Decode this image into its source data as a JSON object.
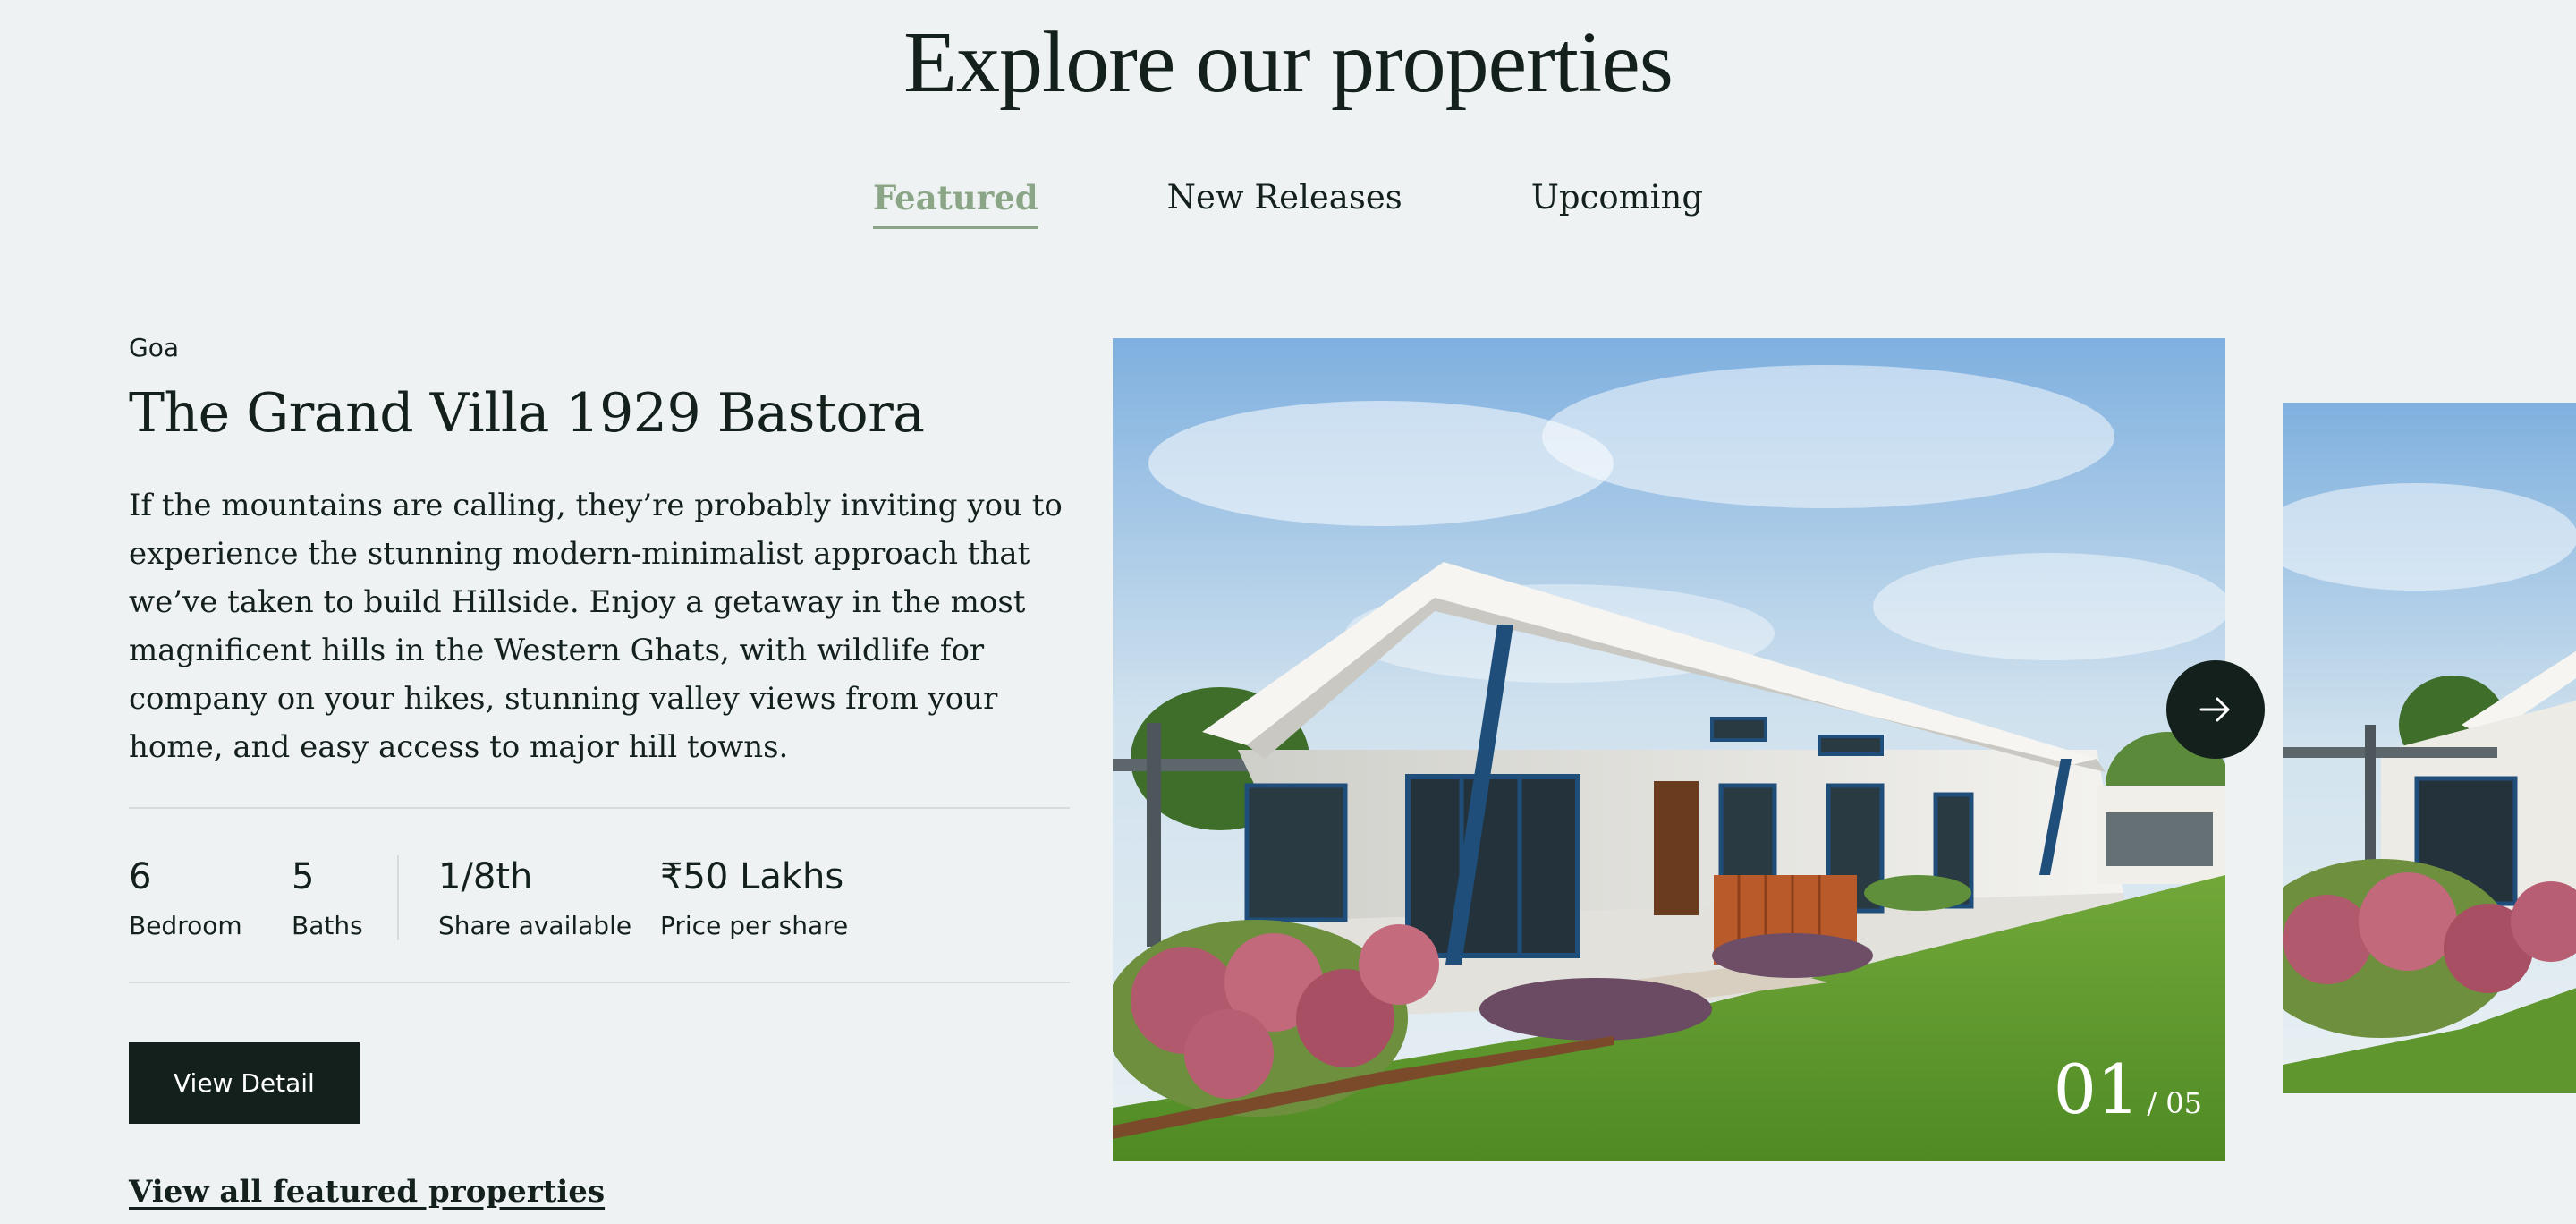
{
  "section": {
    "title": "Explore our properties"
  },
  "tabs": [
    {
      "label": "Featured",
      "active": true
    },
    {
      "label": "New Releases",
      "active": false
    },
    {
      "label": "Upcoming",
      "active": false
    }
  ],
  "property": {
    "location": "Goa",
    "title": "The Grand Villa 1929 Bastora",
    "description": "If the mountains are calling, they’re probably inviting you to experience the stunning modern-minimalist approach that we’ve taken to build Hillside. Enjoy a getaway in the most magnificent hills in the Western Ghats, with wildlife for company on your hikes, stunning valley views from your home, and easy access to major hill towns.",
    "stats": {
      "bedroom": {
        "value": "6",
        "label": "Bedroom"
      },
      "baths": {
        "value": "5",
        "label": "Baths"
      },
      "share": {
        "value": "1/8th",
        "label": "Share available"
      },
      "price": {
        "value": "₹50 Lakhs",
        "label": "Price per share"
      }
    }
  },
  "actions": {
    "view_detail": "View Detail",
    "view_all": "View all featured properties"
  },
  "carousel": {
    "current": "01",
    "total": "/ 05",
    "next_icon": "arrow-right-icon"
  },
  "colors": {
    "background": "#eef2f3",
    "dark": "#13201c",
    "accent": "#8aa686",
    "divider": "#d6dbdc"
  }
}
